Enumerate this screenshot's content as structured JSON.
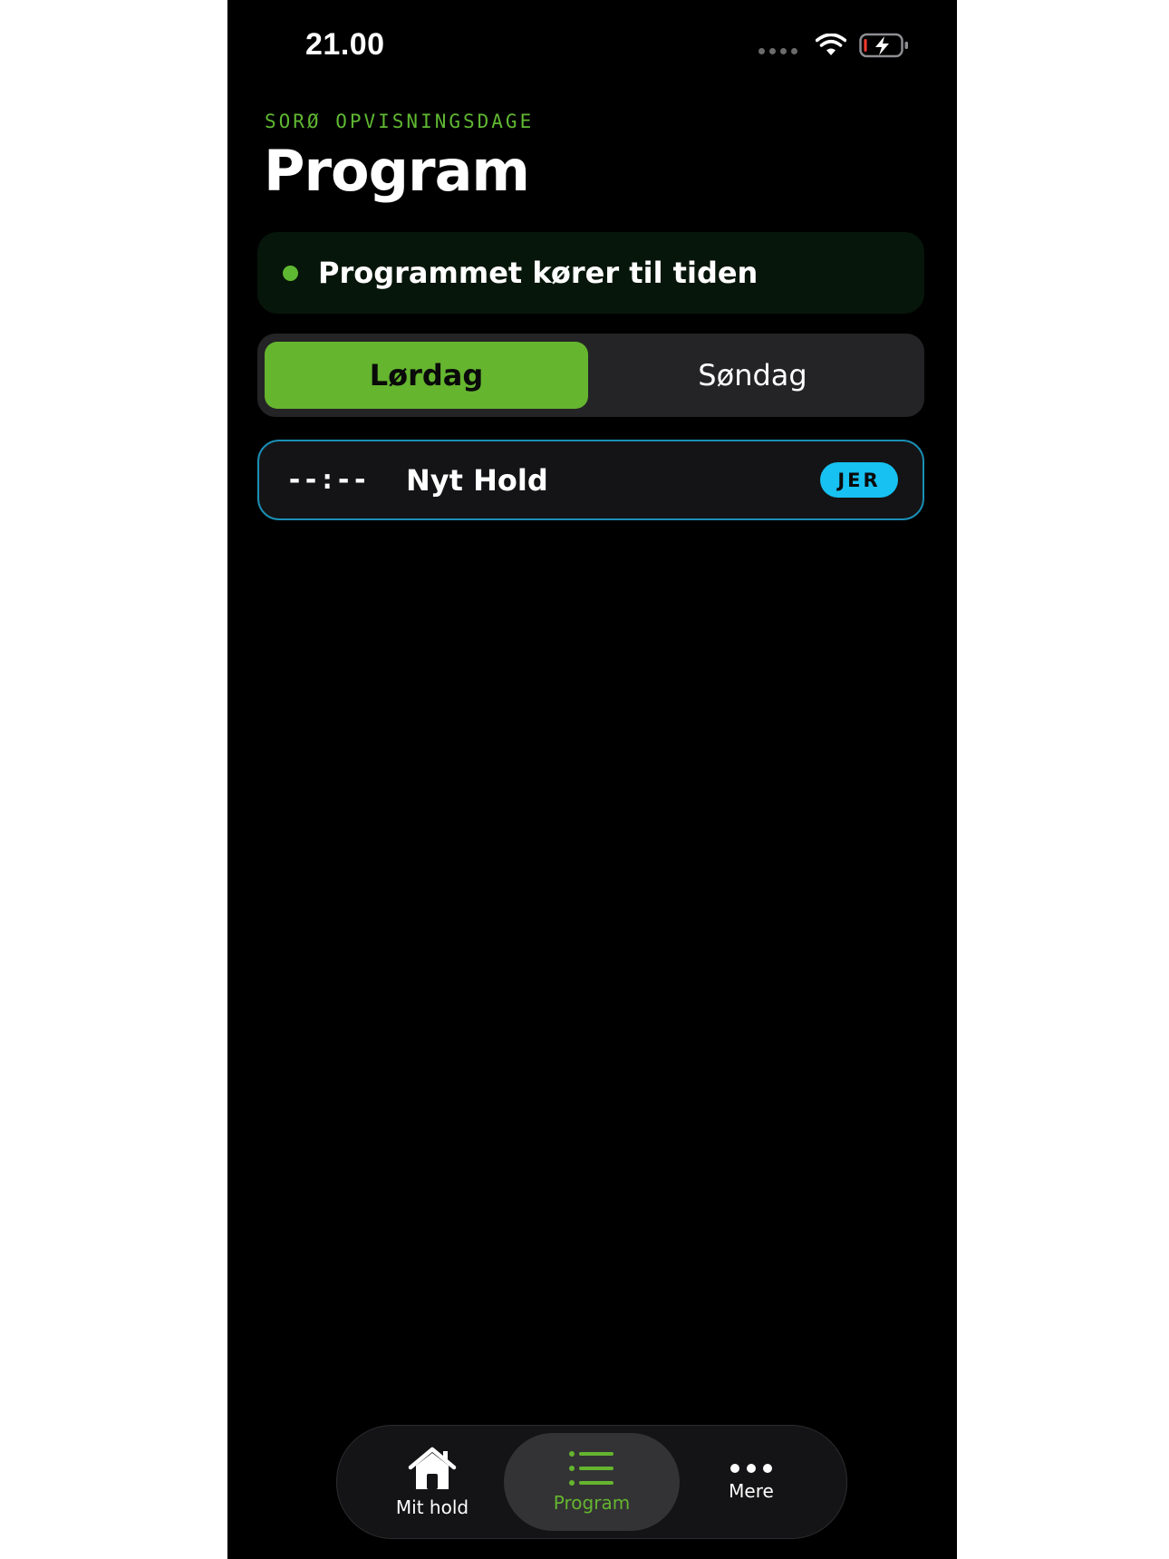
{
  "status_bar": {
    "time": "21.00"
  },
  "header": {
    "eyebrow": "SORØ OPVISNINGSDAGE",
    "title": "Program"
  },
  "banner": {
    "text": "Programmet kører til tiden"
  },
  "day_selector": {
    "options": [
      {
        "label": "Lørdag",
        "selected": true
      },
      {
        "label": "Søndag",
        "selected": false
      }
    ]
  },
  "program": {
    "items": [
      {
        "time": "--:--",
        "title": "Nyt Hold",
        "badge": "JER"
      }
    ]
  },
  "tabbar": {
    "tabs": [
      {
        "label": "Mit hold",
        "icon": "home-icon",
        "selected": false
      },
      {
        "label": "Program",
        "icon": "list-icon",
        "selected": true
      },
      {
        "label": "Mere",
        "icon": "more-icon",
        "selected": false
      }
    ]
  },
  "colors": {
    "accent": "#65b52f",
    "badge": "#17c1f2",
    "highlight_border": "#1b8fb6",
    "background": "#000000"
  }
}
